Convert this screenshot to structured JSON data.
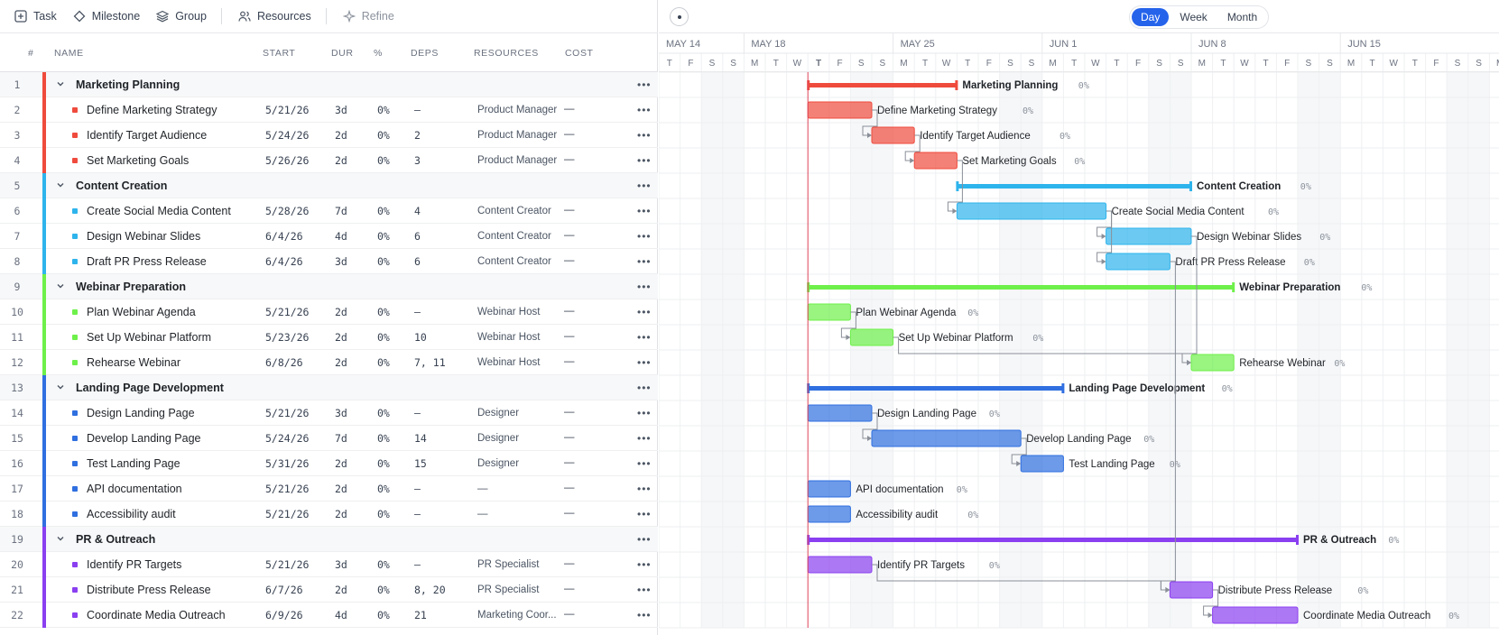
{
  "toolbar": {
    "task": "Task",
    "milestone": "Milestone",
    "group": "Group",
    "resources": "Resources",
    "refine": "Refine"
  },
  "columns": {
    "num": "#",
    "name": "NAME",
    "start": "START",
    "dur": "DUR",
    "pct": "%",
    "deps": "DEPS",
    "resources": "RESOURCES",
    "cost": "COST"
  },
  "view": {
    "options": [
      "Day",
      "Week",
      "Month"
    ],
    "selected": "Day"
  },
  "timeline": {
    "weeks": [
      "MAY 14",
      "MAY 18",
      "MAY 25",
      "JUN 1",
      "JUN 8",
      "JUN 15"
    ],
    "day_letters": [
      "T",
      "F",
      "S",
      "S",
      "M",
      "T",
      "W",
      "T",
      "F",
      "S",
      "S",
      "M",
      "T",
      "W",
      "T",
      "F",
      "S",
      "S",
      "M",
      "T",
      "W",
      "T",
      "F",
      "S",
      "S",
      "M",
      "T",
      "W",
      "T",
      "F",
      "S",
      "S",
      "M",
      "T",
      "W",
      "T",
      "F",
      "S",
      "S",
      "M"
    ],
    "today_index": 7
  },
  "colors": {
    "Marketing Planning": "#ef4b3d",
    "Content Creation": "#2eb4ec",
    "Webinar Preparation": "#6ef04a",
    "Landing Page Development": "#2f6fe0",
    "PR & Outreach": "#8a3ff0",
    "today": "#e0475a"
  },
  "rows": [
    {
      "num": "1",
      "kind": "group",
      "name": "Marketing Planning",
      "colorKey": "Marketing Planning",
      "pct": "0%",
      "s": 7,
      "e": 14
    },
    {
      "num": "2",
      "kind": "task",
      "name": "Define Marketing Strategy",
      "colorKey": "Marketing Planning",
      "start": "5/21/26",
      "dur": "3d",
      "pct": "0%",
      "deps": "—",
      "resources": "Product Manager",
      "cost": "—",
      "s": 7,
      "e": 10
    },
    {
      "num": "3",
      "kind": "task",
      "name": "Identify Target Audience",
      "colorKey": "Marketing Planning",
      "start": "5/24/26",
      "dur": "2d",
      "pct": "0%",
      "deps": "2",
      "resources": "Product Manager",
      "cost": "—",
      "s": 10,
      "e": 12
    },
    {
      "num": "4",
      "kind": "task",
      "name": "Set Marketing Goals",
      "colorKey": "Marketing Planning",
      "start": "5/26/26",
      "dur": "2d",
      "pct": "0%",
      "deps": "3",
      "resources": "Product Manager",
      "cost": "—",
      "s": 12,
      "e": 14
    },
    {
      "num": "5",
      "kind": "group",
      "name": "Content Creation",
      "colorKey": "Content Creation",
      "pct": "0%",
      "s": 14,
      "e": 25
    },
    {
      "num": "6",
      "kind": "task",
      "name": "Create Social Media Content",
      "colorKey": "Content Creation",
      "start": "5/28/26",
      "dur": "7d",
      "pct": "0%",
      "deps": "4",
      "resources": "Content Creator",
      "cost": "—",
      "s": 14,
      "e": 21
    },
    {
      "num": "7",
      "kind": "task",
      "name": "Design Webinar Slides",
      "colorKey": "Content Creation",
      "start": "6/4/26",
      "dur": "4d",
      "pct": "0%",
      "deps": "6",
      "resources": "Content Creator",
      "cost": "—",
      "s": 21,
      "e": 25
    },
    {
      "num": "8",
      "kind": "task",
      "name": "Draft PR Press Release",
      "colorKey": "Content Creation",
      "start": "6/4/26",
      "dur": "3d",
      "pct": "0%",
      "deps": "6",
      "resources": "Content Creator",
      "cost": "—",
      "s": 21,
      "e": 24
    },
    {
      "num": "9",
      "kind": "group",
      "name": "Webinar Preparation",
      "colorKey": "Webinar Preparation",
      "pct": "0%",
      "s": 7,
      "e": 27
    },
    {
      "num": "10",
      "kind": "task",
      "name": "Plan Webinar Agenda",
      "colorKey": "Webinar Preparation",
      "start": "5/21/26",
      "dur": "2d",
      "pct": "0%",
      "deps": "—",
      "resources": "Webinar Host",
      "cost": "—",
      "s": 7,
      "e": 9
    },
    {
      "num": "11",
      "kind": "task",
      "name": "Set Up Webinar Platform",
      "colorKey": "Webinar Preparation",
      "start": "5/23/26",
      "dur": "2d",
      "pct": "0%",
      "deps": "10",
      "resources": "Webinar Host",
      "cost": "—",
      "s": 9,
      "e": 11
    },
    {
      "num": "12",
      "kind": "task",
      "name": "Rehearse Webinar",
      "colorKey": "Webinar Preparation",
      "start": "6/8/26",
      "dur": "2d",
      "pct": "0%",
      "deps": "7, 11",
      "resources": "Webinar Host",
      "cost": "—",
      "s": 25,
      "e": 27
    },
    {
      "num": "13",
      "kind": "group",
      "name": "Landing Page Development",
      "colorKey": "Landing Page Development",
      "pct": "0%",
      "s": 7,
      "e": 19
    },
    {
      "num": "14",
      "kind": "task",
      "name": "Design Landing Page",
      "colorKey": "Landing Page Development",
      "start": "5/21/26",
      "dur": "3d",
      "pct": "0%",
      "deps": "—",
      "resources": "Designer",
      "cost": "—",
      "s": 7,
      "e": 10
    },
    {
      "num": "15",
      "kind": "task",
      "name": "Develop Landing Page",
      "colorKey": "Landing Page Development",
      "start": "5/24/26",
      "dur": "7d",
      "pct": "0%",
      "deps": "14",
      "resources": "Designer",
      "cost": "—",
      "s": 10,
      "e": 17
    },
    {
      "num": "16",
      "kind": "task",
      "name": "Test Landing Page",
      "colorKey": "Landing Page Development",
      "start": "5/31/26",
      "dur": "2d",
      "pct": "0%",
      "deps": "15",
      "resources": "Designer",
      "cost": "—",
      "s": 17,
      "e": 19
    },
    {
      "num": "17",
      "kind": "task",
      "name": "API documentation",
      "colorKey": "Landing Page Development",
      "start": "5/21/26",
      "dur": "2d",
      "pct": "0%",
      "deps": "—",
      "resources": "—",
      "cost": "—",
      "s": 7,
      "e": 9
    },
    {
      "num": "18",
      "kind": "task",
      "name": "Accessibility audit",
      "colorKey": "Landing Page Development",
      "start": "5/21/26",
      "dur": "2d",
      "pct": "0%",
      "deps": "—",
      "resources": "—",
      "cost": "—",
      "s": 7,
      "e": 9
    },
    {
      "num": "19",
      "kind": "group",
      "name": "PR & Outreach",
      "colorKey": "PR & Outreach",
      "pct": "0%",
      "s": 7,
      "e": 30
    },
    {
      "num": "20",
      "kind": "task",
      "name": "Identify PR Targets",
      "colorKey": "PR & Outreach",
      "start": "5/21/26",
      "dur": "3d",
      "pct": "0%",
      "deps": "—",
      "resources": "PR Specialist",
      "cost": "—",
      "s": 7,
      "e": 10
    },
    {
      "num": "21",
      "kind": "task",
      "name": "Distribute Press Release",
      "colorKey": "PR & Outreach",
      "start": "6/7/26",
      "dur": "2d",
      "pct": "0%",
      "deps": "8, 20",
      "resources": "PR Specialist",
      "cost": "—",
      "s": 24,
      "e": 26
    },
    {
      "num": "22",
      "kind": "task",
      "name": "Coordinate Media Outreach",
      "colorKey": "PR & Outreach",
      "start": "6/9/26",
      "dur": "4d",
      "pct": "0%",
      "deps": "21",
      "resources": "Marketing Coor...",
      "cost": "—",
      "s": 26,
      "e": 30
    }
  ]
}
